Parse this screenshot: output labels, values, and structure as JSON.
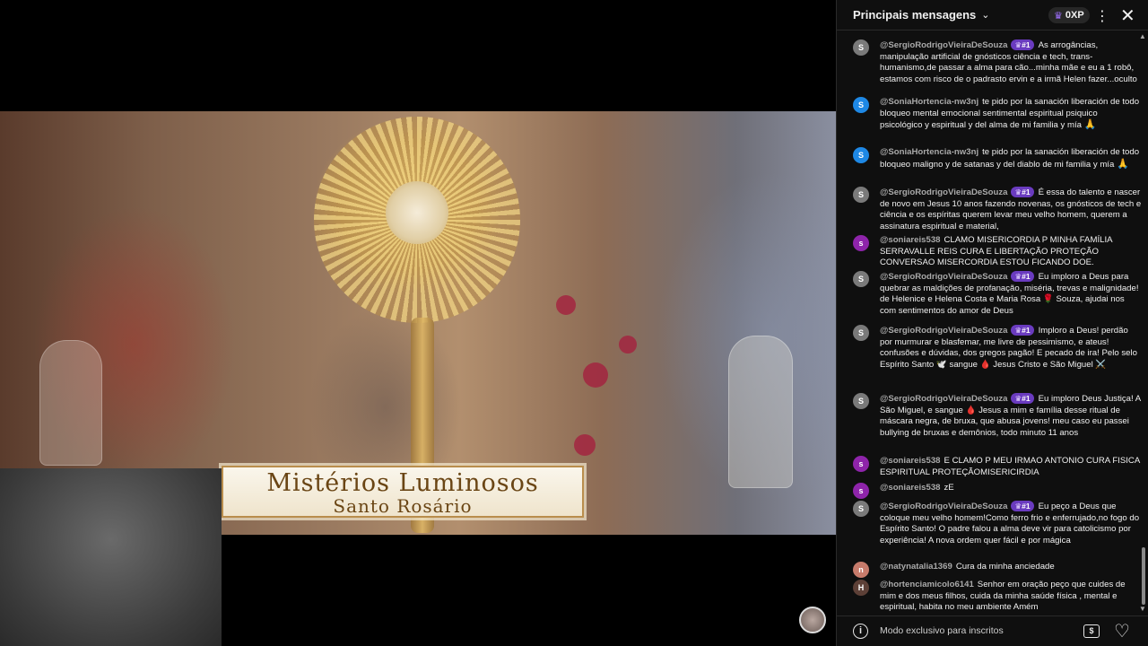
{
  "video": {
    "title_line1": "Mistérios Luminosos",
    "title_line2": "Santo Rosário"
  },
  "chat": {
    "header_title": "Principais mensagens",
    "xp_badge": "0XP",
    "footer_mode": "Modo exclusivo para inscritos",
    "messages": [
      {
        "author": "@SergioRodrigoVieiraDeSouza",
        "badge": "#1",
        "avatar": "S",
        "avatar_color": "#7a7a7a",
        "text": "As arrogâncias, manipulação artificial de gnósticos ciência e tech, trans-humanismo,de passar a alma para cão...minha mãe e eu a 1 robô, estamos com risco de o padrasto ervin e a irmã Helen fazer...oculto"
      },
      {
        "author": "@SoniaHortencia-nw3nj",
        "badge": "",
        "avatar": "S",
        "avatar_color": "#1e88e5",
        "text": "te pido por la sanación liberación de todo bloqueo mental emocional sentimental espiritual psiquico psicológico y espiritual y del alma de mi familia y mía",
        "emoji": "🙏"
      },
      {
        "author": "@SoniaHortencia-nw3nj",
        "badge": "",
        "avatar": "S",
        "avatar_color": "#1e88e5",
        "text": "te pido por la sanación liberación de todo bloqueo maligno y de satanas y del diablo de mi familia y mía",
        "emoji": "🙏"
      },
      {
        "author": "@SergioRodrigoVieiraDeSouza",
        "badge": "#1",
        "avatar": "S",
        "avatar_color": "#7a7a7a",
        "text": "É essa do talento e nascer de novo em Jesus 10 anos fazendo novenas, os gnósticos de tech e ciência e os espíritas querem levar meu velho homem, querem a assinatura espiritual e material,"
      },
      {
        "author": "@soniareis538",
        "badge": "",
        "avatar": "s",
        "avatar_color": "#8e24aa",
        "text": "CLAMO MISERICORDIA P MINHA FAMÍLIA SERRAVALLE REIS CURA E LIBERTAÇÃO PROTEÇÃO CONVERSAO MISERCORDIA ESTOU FICANDO DOE."
      },
      {
        "author": "@SergioRodrigoVieiraDeSouza",
        "badge": "#1",
        "avatar": "S",
        "avatar_color": "#7a7a7a",
        "text": "Eu imploro a Deus para quebrar as maldições de profanação, miséria, trevas e malignidade! de Helenice e Helena Costa e Maria Rosa 🌹 Souza, ajudai nos com sentimentos do amor de Deus"
      },
      {
        "author": "@SergioRodrigoVieiraDeSouza",
        "badge": "#1",
        "avatar": "S",
        "avatar_color": "#7a7a7a",
        "text": "Imploro a Deus! perdão por murmurar e blasfemar, me livre de pessimismo, e ateus! confusões e dúvidas, dos gregos pagão! E pecado de ira! Pelo selo Espírito Santo 🕊️ sangue 🩸 Jesus Cristo e São Miguel ⚔️"
      },
      {
        "author": "@SergioRodrigoVieiraDeSouza",
        "badge": "#1",
        "avatar": "S",
        "avatar_color": "#7a7a7a",
        "text": "Eu imploro Deus Justiça! A São Miguel, e sangue 🩸 Jesus a mim e família desse ritual de máscara negra, de bruxa, que abusa jovens! meu caso eu passei bullying de bruxas e demônios, todo minuto 11 anos"
      },
      {
        "author": "@soniareis538",
        "badge": "",
        "avatar": "s",
        "avatar_color": "#8e24aa",
        "text": "E CLAMO P MEU IRMAO ANTONIO CURA FISICA ESPIRITUAL PROTEÇÃOMISERICIRDIA"
      },
      {
        "author": "@soniareis538",
        "badge": "",
        "avatar": "s",
        "avatar_color": "#8e24aa",
        "text": "zE"
      },
      {
        "author": "@SergioRodrigoVieiraDeSouza",
        "badge": "#1",
        "avatar": "S",
        "avatar_color": "#7a7a7a",
        "text": "Eu peço a Deus que coloque meu velho homem!Como ferro frio e enferrujado,no fogo do Espírito Santo! O padre falou a alma deve vir para catolicismo por experiência! A nova ordem quer fácil e por mágica"
      },
      {
        "author": "@natynatalia1369",
        "badge": "",
        "avatar": "n",
        "avatar_color": "#c77b6b",
        "text": "Cura da minha anciedade"
      },
      {
        "author": "@hortenciamicolo6141",
        "badge": "",
        "avatar": "H",
        "avatar_color": "#5d4037",
        "text": "Senhor em oração peço que cuides de mim e dos meus filhos, cuida da minha saúde física , mental e espiritual, habita no meu ambiente Amém"
      }
    ]
  },
  "icons": {
    "crown": "♛",
    "chevron": "⌄",
    "kebab": "⋮",
    "close": "✕",
    "info": "i",
    "money": "$",
    "heart": "♡"
  }
}
